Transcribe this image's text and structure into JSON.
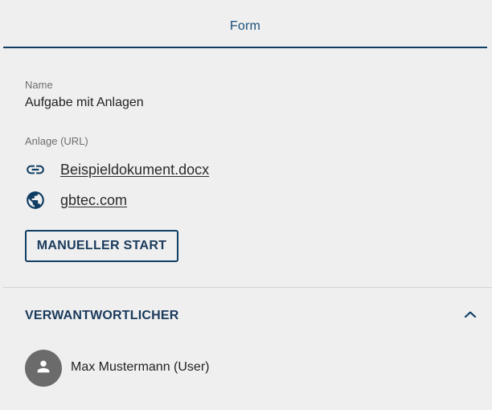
{
  "tabs": {
    "active_label": "Form"
  },
  "form": {
    "name_label": "Name",
    "name_value": "Aufgabe mit Anlagen",
    "attachment_label": "Anlage (URL)",
    "attachments": [
      {
        "icon": "link-icon",
        "text": "Beispieldokument.docx"
      },
      {
        "icon": "globe-icon",
        "text": "gbtec.com"
      }
    ],
    "manual_start_label": "MANUELLER START"
  },
  "responsible_section": {
    "title": "VERWANTWORTLICHER",
    "toggle_icon": "chevron-up-icon",
    "users": [
      {
        "avatar_icon": "person-icon",
        "name": "Max Mustermann (User)"
      }
    ]
  },
  "colors": {
    "background": "#efefef",
    "accent_dark": "#0f3d63",
    "heading_text": "#1a3a5c",
    "tab_text": "#1a4f7a",
    "label_text": "#6e6e6e",
    "avatar_background": "#6b6b6b"
  }
}
